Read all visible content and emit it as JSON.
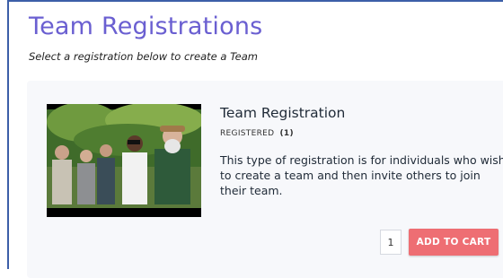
{
  "header": {
    "title": "Team Registrations",
    "subtitle": "Select a registration below to create a Team"
  },
  "registration": {
    "title": "Team Registration",
    "status_label": "REGISTERED",
    "status_count": "(1)",
    "description": "This type of registration is for individuals who wish to create a team and then invite others to join their team.",
    "quantity": "1",
    "add_to_cart_label": "ADD TO CART",
    "button_color": "#ee6e73"
  },
  "theme": {
    "title_color": "#6a5fd1",
    "card_background": "#f7f8fb"
  }
}
